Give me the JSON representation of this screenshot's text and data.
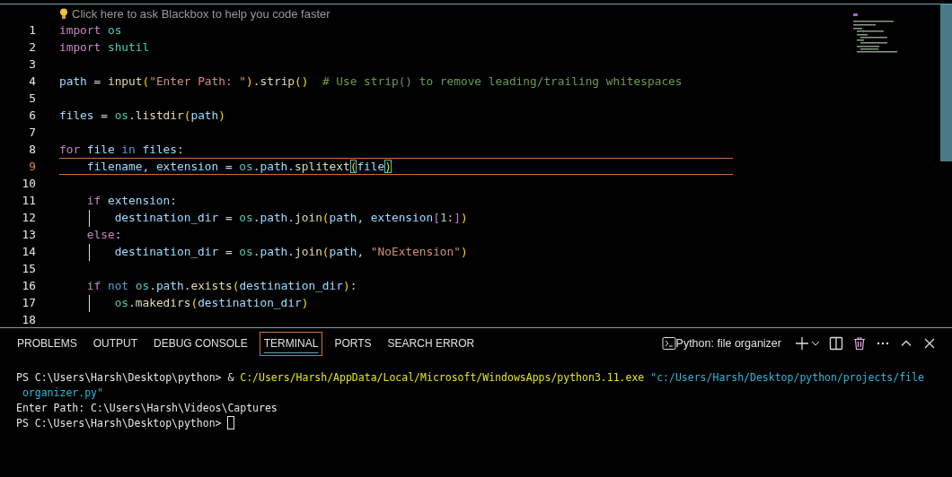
{
  "editor": {
    "hint": "Click here to ask Blackbox to help you code faster",
    "lines": [
      {
        "number": "1",
        "current": false,
        "guide": false,
        "tokens": [
          {
            "text": "import",
            "kind": "keyword"
          },
          {
            "text": " os",
            "kind": "module"
          }
        ]
      },
      {
        "number": "2",
        "current": false,
        "guide": false,
        "tokens": [
          {
            "text": "import",
            "kind": "keyword"
          },
          {
            "text": " shutil",
            "kind": "module"
          }
        ]
      },
      {
        "number": "3",
        "current": false
      },
      {
        "number": "4",
        "current": false,
        "guide": false,
        "tokens": [
          {
            "text": "path",
            "kind": "variable"
          },
          {
            "text": " = ",
            "kind": "plain"
          },
          {
            "text": "input",
            "kind": "function"
          },
          {
            "text": "(",
            "kind": "bracket"
          },
          {
            "text": "\"Enter Path: \"",
            "kind": "string"
          },
          {
            "text": ")",
            "kind": "bracket"
          },
          {
            "text": ".",
            "kind": "plain"
          },
          {
            "text": "strip",
            "kind": "function"
          },
          {
            "text": "()",
            "kind": "bracket"
          },
          {
            "text": "  # Use strip() to remove leading/trailing whitespaces",
            "kind": "comment"
          }
        ]
      },
      {
        "number": "5",
        "current": false
      },
      {
        "number": "6",
        "current": false,
        "guide": false,
        "tokens": [
          {
            "text": "files",
            "kind": "variable"
          },
          {
            "text": " = ",
            "kind": "plain"
          },
          {
            "text": "os",
            "kind": "module"
          },
          {
            "text": ".",
            "kind": "plain"
          },
          {
            "text": "listdir",
            "kind": "function"
          },
          {
            "text": "(",
            "kind": "bracket"
          },
          {
            "text": "path",
            "kind": "variable"
          },
          {
            "text": ")",
            "kind": "bracket"
          }
        ]
      },
      {
        "number": "7",
        "current": false
      },
      {
        "number": "8",
        "current": false,
        "guide": false,
        "tokens": [
          {
            "text": "for",
            "kind": "keyword"
          },
          {
            "text": " file",
            "kind": "variable"
          },
          {
            "text": " in",
            "kind": "operator"
          },
          {
            "text": " files",
            "kind": "variable"
          },
          {
            "text": ":",
            "kind": "plain"
          }
        ]
      },
      {
        "number": "9",
        "current": true,
        "guide": false,
        "tokens": [
          {
            "text": "    filename",
            "kind": "variable"
          },
          {
            "text": ", ",
            "kind": "plain"
          },
          {
            "text": "extension",
            "kind": "variable"
          },
          {
            "text": " = ",
            "kind": "plain"
          },
          {
            "text": "os",
            "kind": "module"
          },
          {
            "text": ".",
            "kind": "plain"
          },
          {
            "text": "path",
            "kind": "variable"
          },
          {
            "text": ".",
            "kind": "plain"
          },
          {
            "text": "splitext",
            "kind": "function"
          },
          {
            "text": "(",
            "kind": "match"
          },
          {
            "text": "file",
            "kind": "variable"
          },
          {
            "text": ")",
            "kind": "match"
          }
        ]
      },
      {
        "number": "10",
        "current": false
      },
      {
        "number": "11",
        "current": false,
        "guide": false,
        "tokens": [
          {
            "text": "    if",
            "kind": "keyword"
          },
          {
            "text": " extension",
            "kind": "variable"
          },
          {
            "text": ":",
            "kind": "plain"
          }
        ]
      },
      {
        "number": "12",
        "current": false,
        "guide": true,
        "tokens": [
          {
            "text": "        destination_dir",
            "kind": "variable"
          },
          {
            "text": " = ",
            "kind": "plain"
          },
          {
            "text": "os",
            "kind": "module"
          },
          {
            "text": ".",
            "kind": "plain"
          },
          {
            "text": "path",
            "kind": "variable"
          },
          {
            "text": ".",
            "kind": "plain"
          },
          {
            "text": "join",
            "kind": "function"
          },
          {
            "text": "(",
            "kind": "bracket"
          },
          {
            "text": "path",
            "kind": "variable"
          },
          {
            "text": ", ",
            "kind": "plain"
          },
          {
            "text": "extension",
            "kind": "variable"
          },
          {
            "text": "[",
            "kind": "bracket2"
          },
          {
            "text": "1",
            "kind": "number"
          },
          {
            "text": ":",
            "kind": "plain"
          },
          {
            "text": "]",
            "kind": "bracket2"
          },
          {
            "text": ")",
            "kind": "bracket"
          }
        ]
      },
      {
        "number": "13",
        "current": false,
        "guide": false,
        "tokens": [
          {
            "text": "    else",
            "kind": "keyword"
          },
          {
            "text": ":",
            "kind": "plain"
          }
        ]
      },
      {
        "number": "14",
        "current": false,
        "guide": true,
        "tokens": [
          {
            "text": "        destination_dir",
            "kind": "variable"
          },
          {
            "text": " = ",
            "kind": "plain"
          },
          {
            "text": "os",
            "kind": "module"
          },
          {
            "text": ".",
            "kind": "plain"
          },
          {
            "text": "path",
            "kind": "variable"
          },
          {
            "text": ".",
            "kind": "plain"
          },
          {
            "text": "join",
            "kind": "function"
          },
          {
            "text": "(",
            "kind": "bracket"
          },
          {
            "text": "path",
            "kind": "variable"
          },
          {
            "text": ", ",
            "kind": "plain"
          },
          {
            "text": "\"NoExtension\"",
            "kind": "string"
          },
          {
            "text": ")",
            "kind": "bracket"
          }
        ]
      },
      {
        "number": "15",
        "current": false
      },
      {
        "number": "16",
        "current": false,
        "guide": false,
        "tokens": [
          {
            "text": "    if",
            "kind": "keyword"
          },
          {
            "text": " not",
            "kind": "operator"
          },
          {
            "text": " os",
            "kind": "module"
          },
          {
            "text": ".",
            "kind": "plain"
          },
          {
            "text": "path",
            "kind": "variable"
          },
          {
            "text": ".",
            "kind": "plain"
          },
          {
            "text": "exists",
            "kind": "function"
          },
          {
            "text": "(",
            "kind": "bracket"
          },
          {
            "text": "destination_dir",
            "kind": "variable"
          },
          {
            "text": ")",
            "kind": "bracket"
          },
          {
            "text": ":",
            "kind": "plain"
          }
        ]
      },
      {
        "number": "17",
        "current": false,
        "guide": true,
        "tokens": [
          {
            "text": "        os",
            "kind": "module"
          },
          {
            "text": ".",
            "kind": "plain"
          },
          {
            "text": "makedirs",
            "kind": "function"
          },
          {
            "text": "(",
            "kind": "bracket"
          },
          {
            "text": "destination_dir",
            "kind": "variable"
          },
          {
            "text": ")",
            "kind": "bracket"
          }
        ]
      },
      {
        "number": "18",
        "current": false
      }
    ]
  },
  "panel": {
    "tabs": [
      {
        "label": "PROBLEMS",
        "selected": false
      },
      {
        "label": "OUTPUT",
        "selected": false
      },
      {
        "label": "DEBUG CONSOLE",
        "selected": false
      },
      {
        "label": "TERMINAL",
        "selected": true
      },
      {
        "label": "PORTS",
        "selected": false
      },
      {
        "label": "SEARCH ERROR",
        "selected": false
      }
    ],
    "terminal_name": "Python: file organizer",
    "terminal_lines": [
      {
        "segments": [
          {
            "text": "PS C:\\Users\\Harsh\\Desktop\\python> & ",
            "kind": "plain"
          },
          {
            "text": "C:/Users/Harsh/AppData/Local/Microsoft/WindowsApps/python3.11.exe",
            "kind": "path"
          },
          {
            "text": " \"c:/Users/Harsh/Desktop/python/projects/file",
            "kind": "string"
          }
        ],
        "cursor": false
      },
      {
        "segments": [
          {
            "text": " organizer.py\"",
            "kind": "string"
          }
        ],
        "cursor": false
      },
      {
        "segments": [
          {
            "text": "Enter Path: C:\\Users\\Harsh\\Videos\\Captures",
            "kind": "plain"
          }
        ],
        "cursor": false
      },
      {
        "segments": [
          {
            "text": "PS C:\\Users\\Harsh\\Desktop\\python> ",
            "kind": "plain"
          }
        ],
        "cursor": true
      }
    ]
  }
}
